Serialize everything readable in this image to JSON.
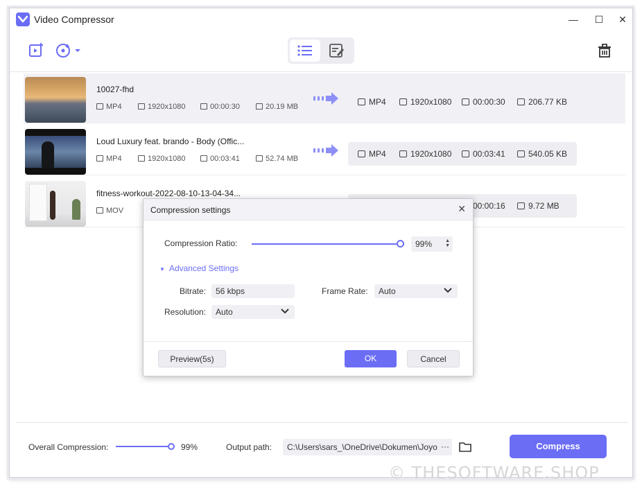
{
  "app": {
    "title": "Video Compressor"
  },
  "window_controls": {
    "minimize": "—",
    "maximize": "☐",
    "close": "✕"
  },
  "files": [
    {
      "name": "10027-fhd",
      "source": {
        "format": "MP4",
        "resolution": "1920x1080",
        "duration": "00:00:30",
        "size": "20.19 MB"
      },
      "output": {
        "format": "MP4",
        "resolution": "1920x1080",
        "duration": "00:00:30",
        "size": "206.77 KB"
      }
    },
    {
      "name": "Loud Luxury feat. brando - Body (Offic...",
      "source": {
        "format": "MP4",
        "resolution": "1920x1080",
        "duration": "00:03:41",
        "size": "52.74 MB"
      },
      "output": {
        "format": "MP4",
        "resolution": "1920x1080",
        "duration": "00:03:41",
        "size": "540.05 KB"
      }
    },
    {
      "name": "fitness-workout-2022-08-10-13-04-34...",
      "source": {
        "format": "MOV"
      },
      "output": {
        "duration": "00:00:16",
        "size": "9.72 MB"
      }
    }
  ],
  "dialog": {
    "title": "Compression settings",
    "close": "✕",
    "ratio_label": "Compression Ratio:",
    "ratio_value": "99%",
    "ratio_fraction": 0.99,
    "advanced_label": "Advanced Settings",
    "bitrate_label": "Bitrate:",
    "bitrate_value": "56 kbps",
    "framerate_label": "Frame Rate:",
    "framerate_value": "Auto",
    "resolution_label": "Resolution:",
    "resolution_value": "Auto",
    "preview_button": "Preview(5s)",
    "ok_button": "OK",
    "cancel_button": "Cancel"
  },
  "bottom": {
    "overall_label": "Overall Compression:",
    "overall_value": "99%",
    "output_label": "Output path:",
    "output_path": "C:\\Users\\sars_\\OneDrive\\Dokumen\\Joyo",
    "more": "···",
    "compress_button": "Compress"
  },
  "watermark": "© THESOFTWARE.SHOP",
  "colors": {
    "accent": "#6b6df5",
    "selected_row": "#f0f0f5",
    "field_bg": "#f0f0f4"
  }
}
